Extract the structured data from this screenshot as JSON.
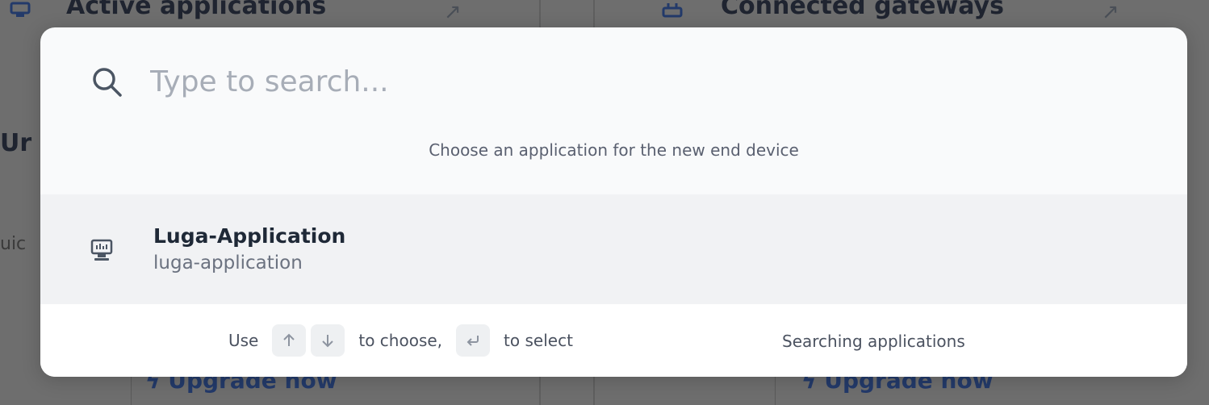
{
  "background": {
    "left_card_title": "Active applications",
    "right_card_title": "Connected gateways",
    "side_heading": "Ur",
    "side_subtext": "uic",
    "left_upgrade": "Upgrade now",
    "right_upgrade": "Upgrade now"
  },
  "search": {
    "placeholder": "Type to search...",
    "value": "",
    "hint": "Choose an application for the new end device"
  },
  "results": [
    {
      "name": "Luga-Application",
      "id": "luga-application",
      "icon": "application-icon"
    }
  ],
  "footer": {
    "use_label": "Use",
    "choose_label": "to choose,",
    "select_label": "to select",
    "status": "Searching applications",
    "keys": [
      "arrow-up-icon",
      "arrow-down-icon",
      "enter-icon"
    ]
  },
  "colors": {
    "overlay": "#6e6e6e",
    "modal_bg": "#f9fafb",
    "selected_row": "#f1f2f4",
    "footer_bg": "#ffffff",
    "kbd_bg": "#eef0f2"
  }
}
